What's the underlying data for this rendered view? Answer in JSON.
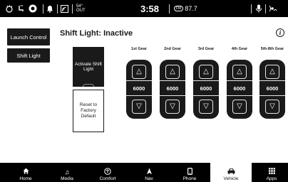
{
  "status_bar": {
    "temperature": "54°",
    "temperature_label": "OUT",
    "time": "3:58",
    "radio_band": "FM",
    "radio_frequency": "87.7"
  },
  "left_menu": [
    {
      "label": "Launch Control"
    },
    {
      "label": "Shift Light"
    }
  ],
  "page_title": "Shift Light: Inactive",
  "info_glyph": "i",
  "activate_label": "Activate Shift Light",
  "reset_label": "Reset to Factory Default",
  "gears": [
    {
      "label": "1st Gear",
      "value": "6000"
    },
    {
      "label": "2nd Gear",
      "value": "6000"
    },
    {
      "label": "3rd Gear",
      "value": "6000"
    },
    {
      "label": "4th Gear",
      "value": "6000"
    },
    {
      "label": "5th-8th Gear",
      "value": "6000"
    }
  ],
  "nav": [
    {
      "label": "Home",
      "icon": "home-icon"
    },
    {
      "label": "Media",
      "icon": "music-note-icon"
    },
    {
      "label": "Comfort",
      "icon": "comfort-icon"
    },
    {
      "label": "Nav",
      "icon": "navigation-arrow-icon"
    },
    {
      "label": "Phone",
      "icon": "phone-icon"
    },
    {
      "label": "Vehicle",
      "icon": "car-icon"
    },
    {
      "label": "Apps",
      "icon": "apps-grid-icon"
    }
  ],
  "active_nav": "Vehicle",
  "colors": {
    "background": "#ffffff",
    "bars": "#000000",
    "buttons": "#1a1a1a",
    "text_light": "#ffffff"
  }
}
